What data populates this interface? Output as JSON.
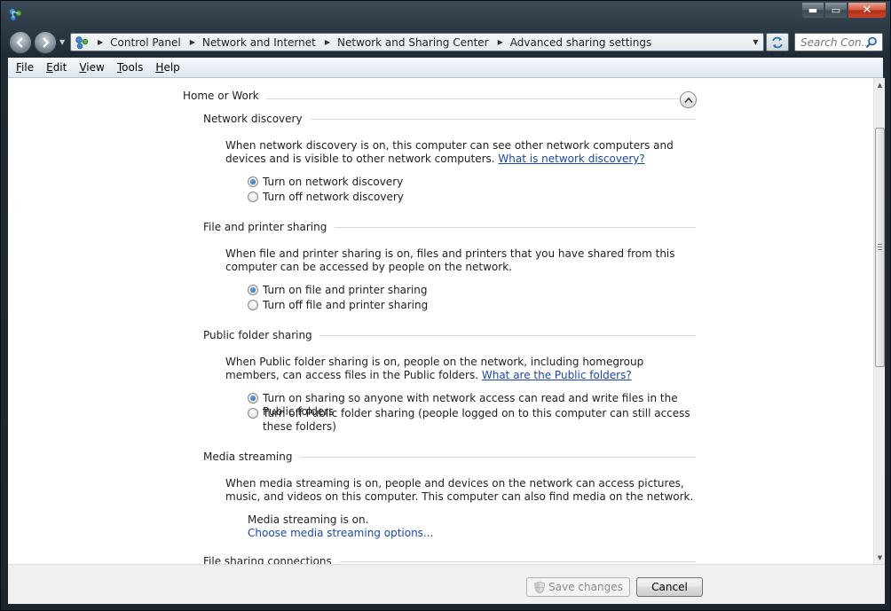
{
  "window": {
    "controls": {
      "minimize": "▬",
      "maximize": "▭",
      "close": "✕"
    }
  },
  "address_bar": {
    "breadcrumbs": [
      "Control Panel",
      "Network and Internet",
      "Network and Sharing Center",
      "Advanced sharing settings"
    ]
  },
  "search": {
    "placeholder": "Search Con..."
  },
  "menu": {
    "items": [
      {
        "accel": "F",
        "rest": "ile"
      },
      {
        "accel": "E",
        "rest": "dit"
      },
      {
        "accel": "V",
        "rest": "iew"
      },
      {
        "accel": "T",
        "rest": "ools"
      },
      {
        "accel": "H",
        "rest": "elp"
      }
    ]
  },
  "profile": {
    "title": "Home or Work"
  },
  "network_discovery": {
    "title": "Network discovery",
    "description": "When network discovery is on, this computer can see other network computers and devices and is visible to other network computers.",
    "link": "What is network discovery?",
    "options": [
      "Turn on network discovery",
      "Turn off network discovery"
    ],
    "selected": 0
  },
  "file_printer_sharing": {
    "title": "File and printer sharing",
    "description": "When file and printer sharing is on, files and printers that you have shared from this computer can be accessed by people on the network.",
    "options": [
      "Turn on file and printer sharing",
      "Turn off file and printer sharing"
    ],
    "selected": 0
  },
  "public_folder_sharing": {
    "title": "Public folder sharing",
    "description": "When Public folder sharing is on, people on the network, including homegroup members, can access files in the Public folders.",
    "link": "What are the Public folders?",
    "options": [
      "Turn on sharing so anyone with network access can read and write files in the Public folders",
      "Turn off Public folder sharing (people logged on to this computer can still access these folders)"
    ],
    "selected": 0
  },
  "media_streaming": {
    "title": "Media streaming",
    "description": "When media streaming is on, people and devices on the network can access pictures, music, and videos on this computer. This computer can also find media on the network.",
    "status": "Media streaming is on.",
    "link": "Choose media streaming options..."
  },
  "file_sharing_connections": {
    "title": "File sharing connections"
  },
  "footer": {
    "save_label": "Save changes",
    "cancel_label": "Cancel"
  },
  "colors": {
    "link": "#1a47a8",
    "menubar": "#dfe7f1",
    "frame": "#202c35"
  }
}
